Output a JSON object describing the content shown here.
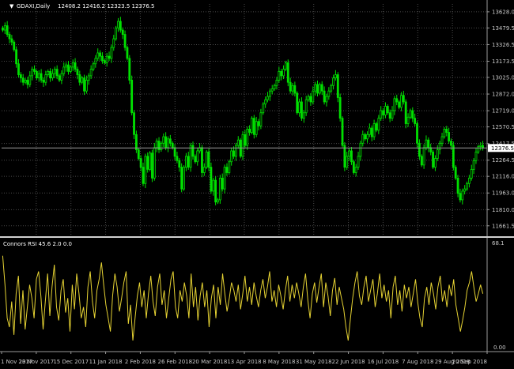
{
  "header": {
    "symbol": "GDAXI,Daily",
    "ohlc": "12408.2 12416.2 12323.5 12376.5",
    "rsi_label": "Connors RSI 45.6 2.0 0.0"
  },
  "colors": {
    "background": "#000000",
    "bull": "#00e000",
    "bear": "#00e000",
    "rsi_line": "#e5d233",
    "current_price_bg": "#ffffff",
    "current_price_fg": "#000000"
  },
  "chart_data": [
    {
      "type": "candlestick",
      "ylim": [
        11580,
        13700
      ],
      "price_ticks": [
        "13628.0",
        "13479.5",
        "13326.5",
        "13173.5",
        "13025.0",
        "12872.0",
        "12719.0",
        "12570.5",
        "12417.5",
        "12264.5",
        "12116.0",
        "11963.0",
        "11810.0",
        "11661.5"
      ],
      "current_price": "12376.5",
      "x_labels": [
        "1 Nov 2017",
        "23 Nov 2017",
        "15 Dec 2017",
        "11 Jan 2018",
        "2 Feb 2018",
        "26 Feb 2018",
        "20 Mar 2018",
        "13 Apr 2018",
        "8 May 2018",
        "31 May 2018",
        "22 Jun 2018",
        "16 Jul 2018",
        "7 Aug 2018",
        "29 Aug 2018",
        "20 Sep 2018"
      ],
      "grid": true,
      "closes": [
        13460,
        13500,
        13420,
        13380,
        13350,
        13280,
        13150,
        13050,
        13020,
        12980,
        13000,
        12960,
        13040,
        13100,
        13080,
        13020,
        13060,
        13000,
        12980,
        13050,
        13080,
        13020,
        13060,
        13100,
        13040,
        13000,
        13060,
        13120,
        13140,
        13080,
        13120,
        13160,
        13100,
        13050,
        12980,
        13020,
        12900,
        13000,
        13040,
        13100,
        13150,
        13200,
        13250,
        13220,
        13180,
        13160,
        13220,
        13200,
        13300,
        13380,
        13480,
        13540,
        13460,
        13420,
        13300,
        13200,
        13000,
        12700,
        12500,
        12360,
        12280,
        12200,
        12050,
        12300,
        12180,
        12330,
        12100,
        12380,
        12440,
        12360,
        12420,
        12480,
        12380,
        12460,
        12420,
        12380,
        12300,
        12260,
        12200,
        12000,
        12200,
        12300,
        12200,
        12400,
        12300,
        12250,
        12350,
        12380,
        12150,
        12200,
        12340,
        12200,
        11980,
        12080,
        11880,
        11900,
        12100,
        12000,
        12200,
        12150,
        12250,
        12350,
        12300,
        12400,
        12450,
        12300,
        12500,
        12400,
        12550,
        12520,
        12650,
        12500,
        12620,
        12580,
        12700,
        12780,
        12820,
        12850,
        12900,
        12920,
        12950,
        13000,
        13080,
        13040,
        13100,
        13160,
        12980,
        12900,
        12950,
        12880,
        12700,
        12800,
        12650,
        12700,
        12820,
        12850,
        12800,
        12900,
        12960,
        12880,
        12960,
        12900,
        12800,
        12850,
        12900,
        12950,
        13020,
        13050,
        12840,
        12650,
        12400,
        12200,
        12300,
        12350,
        12250,
        12150,
        12200,
        12300,
        12420,
        12500,
        12460,
        12500,
        12560,
        12480,
        12600,
        12540,
        12650,
        12720,
        12680,
        12760,
        12700,
        12650,
        12720,
        12830,
        12800,
        12750,
        12860,
        12800,
        12600,
        12660,
        12720,
        12650,
        12600,
        12420,
        12300,
        12220,
        12380,
        12450,
        12380,
        12340,
        12200,
        12280,
        12360,
        12420,
        12480,
        12550,
        12520,
        12440,
        12400,
        12200,
        12100,
        11960,
        11900,
        11980,
        12000,
        12050,
        12100,
        12180,
        12260,
        12340,
        12390,
        12400,
        12376.5
      ]
    },
    {
      "type": "line",
      "ylim": [
        0,
        100
      ],
      "scale_top": "68.1",
      "scale_bottom": "0.00",
      "values": [
        86,
        60,
        30,
        22,
        45,
        15,
        52,
        68,
        25,
        55,
        20,
        40,
        60,
        48,
        30,
        65,
        72,
        50,
        20,
        45,
        70,
        32,
        58,
        78,
        40,
        28,
        55,
        65,
        35,
        48,
        18,
        60,
        38,
        70,
        52,
        30,
        40,
        22,
        58,
        72,
        45,
        30,
        55,
        65,
        80,
        60,
        42,
        30,
        18,
        50,
        70,
        58,
        36,
        48,
        62,
        72,
        25,
        42,
        10,
        30,
        50,
        62,
        40,
        55,
        30,
        52,
        68,
        45,
        32,
        58,
        70,
        42,
        55,
        30,
        48,
        65,
        72,
        40,
        30,
        55,
        45,
        62,
        50,
        30,
        70,
        40,
        58,
        28,
        50,
        62,
        40,
        55,
        22,
        48,
        60,
        30,
        58,
        42,
        70,
        52,
        36,
        48,
        62,
        55,
        45,
        60,
        38,
        52,
        68,
        45,
        58,
        42,
        62,
        50,
        40,
        55,
        65,
        48,
        58,
        72,
        45,
        55,
        40,
        60,
        50,
        38,
        55,
        68,
        45,
        60,
        48,
        62,
        52,
        40,
        58,
        70,
        46,
        30,
        52,
        62,
        44,
        58,
        70,
        40,
        62,
        50,
        32,
        55,
        66,
        42,
        58,
        48,
        38,
        22,
        10,
        30,
        48,
        62,
        72,
        50,
        42,
        58,
        68,
        45,
        55,
        65,
        40,
        52,
        70,
        48,
        60,
        45,
        55,
        30,
        58,
        68,
        42,
        55,
        36,
        60,
        48,
        58,
        40,
        52,
        65,
        44,
        30,
        22,
        48,
        58,
        42,
        62,
        52,
        38,
        58,
        68,
        45,
        55,
        40,
        60,
        50,
        65,
        42,
        30,
        18,
        28,
        40,
        55,
        62,
        72,
        58,
        45,
        52,
        60,
        52
      ]
    }
  ]
}
